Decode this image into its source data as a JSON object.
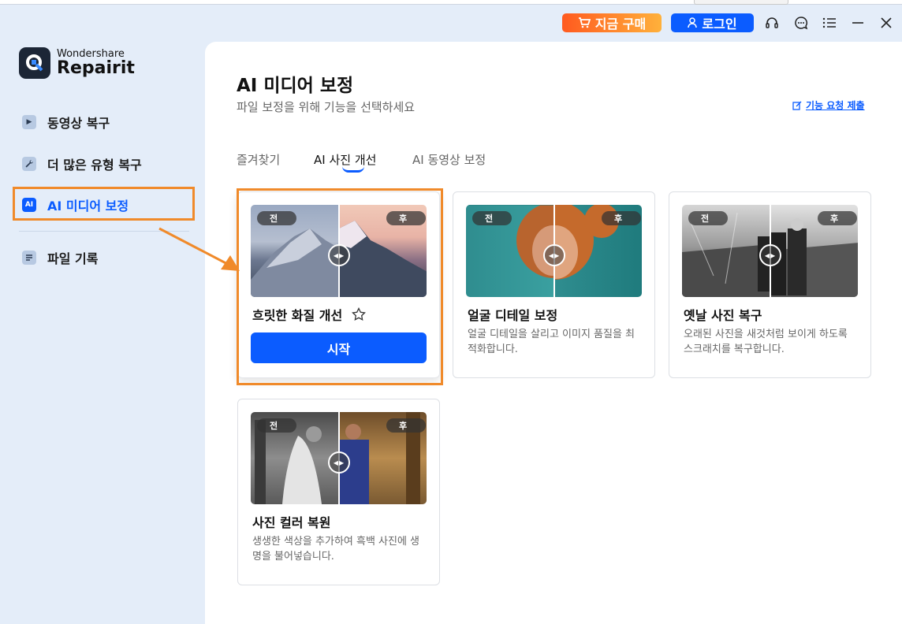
{
  "topbar": {
    "buy_label": "지금 구매",
    "login_label": "로그인"
  },
  "brand": {
    "line1": "Wondershare",
    "line2": "Repairit"
  },
  "sidebar": {
    "items": [
      {
        "label": "동영상 복구",
        "icon": "play-icon"
      },
      {
        "label": "더 많은 유형 복구",
        "icon": "wrench-icon"
      },
      {
        "label": "AI 미디어 보정",
        "icon": "ai-icon",
        "icon_text": "AI"
      },
      {
        "label": "파일 기록",
        "icon": "list-icon"
      }
    ]
  },
  "main": {
    "title": "AI 미디어 보정",
    "subtitle": "파일 보정을 위해 기능을 선택하세요",
    "request_link": "기능 요청 제출",
    "tabs": [
      {
        "label": "즐겨찾기"
      },
      {
        "label": "AI 사진 개선",
        "active": true
      },
      {
        "label": "AI 동영상 보정"
      }
    ],
    "badge_before": "전",
    "badge_after": "후",
    "cards": [
      {
        "title": "흐릿한 화질 개선",
        "button": "시작"
      },
      {
        "title": "얼굴 디테일 보정",
        "desc": "얼굴 디테일을 살리고 이미지 품질을 최적화합니다."
      },
      {
        "title": "옛날 사진 복구",
        "desc": "오래된 사진을 새것처럼 보이게 하도록 스크래치를 복구합니다."
      },
      {
        "title": "사진 컬러 복원",
        "desc": "생생한 색상을 추가하여 흑백 사진에 생명을 불어넣습니다."
      }
    ]
  },
  "colors": {
    "accent": "#0b5cff",
    "highlight": "#f08a2a",
    "buy_gradient_start": "#ff5a1f",
    "buy_gradient_end": "#ffb13b"
  }
}
